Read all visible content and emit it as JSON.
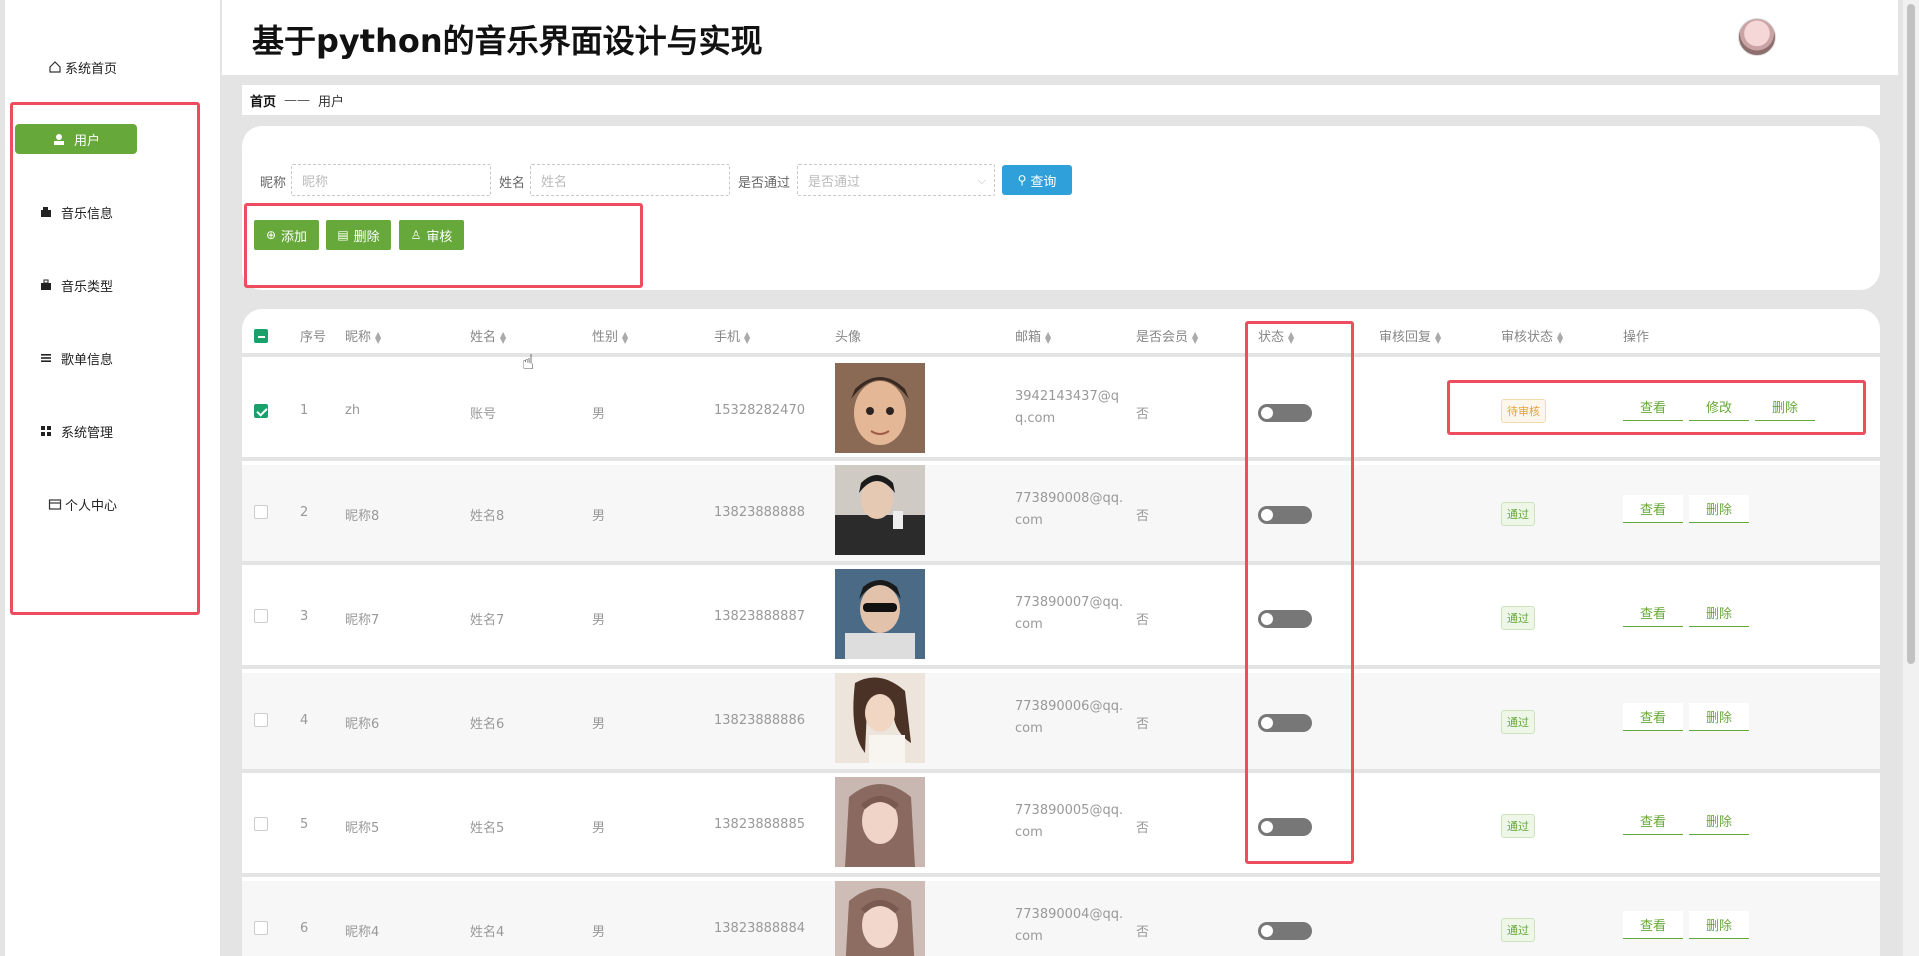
{
  "app": {
    "title": "基于python的音乐界面设计与实现"
  },
  "sidebar": {
    "items": [
      {
        "label": "系统首页",
        "icon": "home-icon"
      },
      {
        "label": "用户",
        "icon": "user-icon",
        "active": true
      },
      {
        "label": "音乐信息",
        "icon": "wallet-icon"
      },
      {
        "label": "音乐类型",
        "icon": "briefcase-icon"
      },
      {
        "label": "歌单信息",
        "icon": "list-icon"
      },
      {
        "label": "系统管理",
        "icon": "grid-icon"
      },
      {
        "label": "个人中心",
        "icon": "card-icon"
      }
    ]
  },
  "breadcrumb": {
    "home": "首页",
    "sep": "——",
    "current": "用户"
  },
  "filters": {
    "nickname_label": "昵称",
    "nickname_placeholder": "昵称",
    "name_label": "姓名",
    "name_placeholder": "姓名",
    "passed_label": "是否通过",
    "passed_placeholder": "是否通过",
    "query_label": "查询"
  },
  "actions": {
    "add": "添加",
    "delete": "删除",
    "review": "审核"
  },
  "table": {
    "headers": [
      "序号",
      "昵称",
      "姓名",
      "性别",
      "手机",
      "头像",
      "邮箱",
      "是否会员",
      "状态",
      "审核回复",
      "审核状态",
      "操作"
    ],
    "rows": [
      {
        "no": "1",
        "nickname": "zh",
        "name": "账号",
        "gender": "男",
        "phone": "15328282470",
        "email1": "3942143437@q",
        "email2": "q.com",
        "member": "否",
        "review_status": "待审核",
        "ops": [
          "查看",
          "修改",
          "删除"
        ]
      },
      {
        "no": "2",
        "nickname": "昵称8",
        "name": "姓名8",
        "gender": "男",
        "phone": "13823888888",
        "email1": "773890008@qq.",
        "email2": "com",
        "member": "否",
        "review_status": "通过",
        "ops": [
          "查看",
          "删除"
        ]
      },
      {
        "no": "3",
        "nickname": "昵称7",
        "name": "姓名7",
        "gender": "男",
        "phone": "13823888887",
        "email1": "773890007@qq.",
        "email2": "com",
        "member": "否",
        "review_status": "通过",
        "ops": [
          "查看",
          "删除"
        ]
      },
      {
        "no": "4",
        "nickname": "昵称6",
        "name": "姓名6",
        "gender": "男",
        "phone": "13823888886",
        "email1": "773890006@qq.",
        "email2": "com",
        "member": "否",
        "review_status": "通过",
        "ops": [
          "查看",
          "删除"
        ]
      },
      {
        "no": "5",
        "nickname": "昵称5",
        "name": "姓名5",
        "gender": "男",
        "phone": "13823888885",
        "email1": "773890005@qq.",
        "email2": "com",
        "member": "否",
        "review_status": "通过",
        "ops": [
          "查看",
          "删除"
        ]
      },
      {
        "no": "6",
        "nickname": "昵称4",
        "name": "姓名4",
        "gender": "男",
        "phone": "13823888884",
        "email1": "773890004@qq.",
        "email2": "com",
        "member": "否",
        "review_status": "通过",
        "ops": [
          "查看",
          "删除"
        ]
      }
    ]
  },
  "colors": {
    "accent_green": "#67a83b",
    "query_blue": "#2fa0d9",
    "highlight_red": "#ee4d5f"
  }
}
